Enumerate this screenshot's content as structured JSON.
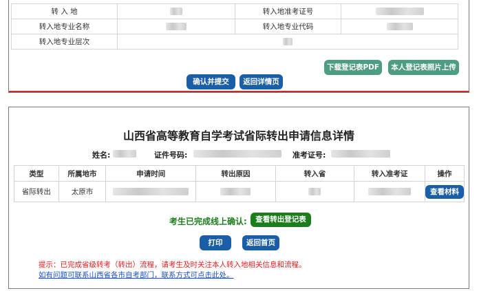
{
  "top_form": {
    "rows": [
      {
        "label1": "转 入 地",
        "label2": "转入地准考证号"
      },
      {
        "label1": "转入地专业名称",
        "label2": "转入地专业代码"
      },
      {
        "label1": "转入地专业层次"
      }
    ],
    "buttons": {
      "download_pdf": "下载登记表PDF",
      "upload_photo": "本人登记表照片上传",
      "confirm_submit": "确认并提交",
      "back_detail": "返回详情页"
    }
  },
  "detail": {
    "title": "山西省高等教育自学考试省际转出申请信息详情",
    "name_label": "姓名:",
    "id_label": "证件号码:",
    "exam_label": "准考证号:",
    "table": {
      "headers": [
        "类型",
        "所属地市",
        "申请时间",
        "转出原因",
        "转入省",
        "转入准考证",
        "操作"
      ],
      "row": {
        "type": "省际转出",
        "city": "太原市",
        "action": "查看材料"
      }
    },
    "confirmed_text": "考生已完成线上确认:",
    "view_form_button": "查看转出登记表",
    "print_button": "打印",
    "home_button": "返回首页",
    "notice": "提示：已完成省级转考（转出）流程，请考生及时关注本人转入地相关信息和流程。",
    "contact_link": "如有问题可联系山西省各市自考部门，联系方式可点击此处。"
  }
}
